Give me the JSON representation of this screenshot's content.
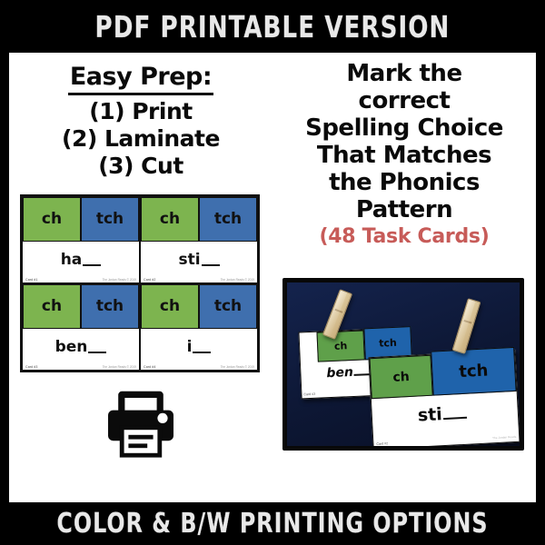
{
  "top_banner": "PDF PRINTABLE VERSION",
  "bottom_banner": "COLOR & B/W PRINTING OPTIONS",
  "colors": {
    "background": "#000000",
    "page": "#ffffff",
    "green_tile": "#7db44f",
    "blue_tile": "#3f6fae",
    "accent_red": "#c75b58",
    "photo_navy": "#0d1734"
  },
  "left_panel": {
    "title": "Easy Prep:",
    "steps": [
      "(1) Print",
      "(2) Laminate",
      "(3) Cut"
    ],
    "printer_icon": "printer-icon"
  },
  "right_panel": {
    "heading_lines": [
      "Mark the",
      "correct",
      "Spelling Choice",
      "That Matches",
      "the Phonics",
      "Pattern"
    ],
    "count_label": "(48 Task Cards)"
  },
  "card_grid": {
    "cards": [
      {
        "choices": [
          "ch",
          "tch"
        ],
        "word": "ha",
        "card_number": "Card #1",
        "credit": "The Jordan Reads © 2019"
      },
      {
        "choices": [
          "ch",
          "tch"
        ],
        "word": "sti",
        "card_number": "Card #2",
        "credit": "The Jordan Reads © 2019"
      },
      {
        "choices": [
          "ch",
          "tch"
        ],
        "word": "ben",
        "card_number": "Card #3",
        "credit": "The Jordan Reads © 2019"
      },
      {
        "choices": [
          "ch",
          "tch"
        ],
        "word": "i",
        "card_number": "Card #4",
        "credit": "The Jordan Reads © 2019"
      }
    ]
  },
  "photo": {
    "card_back": {
      "choices": [
        "ch",
        "tch"
      ],
      "word": "ben",
      "card_number": "Card #3"
    },
    "card_front": {
      "choices": [
        "ch",
        "tch"
      ],
      "word": "sti",
      "card_number": "Card #2",
      "credit": "The Jordan Reads"
    }
  }
}
